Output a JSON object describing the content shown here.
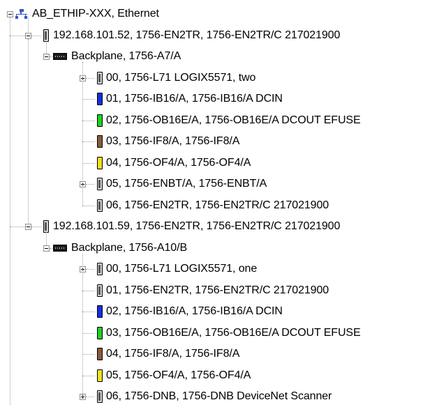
{
  "tree": {
    "root_label": "AB_ETHIP-XXX, Ethernet",
    "adapters": [
      {
        "label": "192.168.101.52, 1756-EN2TR, 1756-EN2TR/C 217021900",
        "backplane": "Backplane, 1756-A7/A",
        "modules": [
          {
            "label": "00, 1756-L71 LOGIX5571, two",
            "color": "#c8c8c8",
            "expandable": true
          },
          {
            "label": "01, 1756-IB16/A, 1756-IB16/A   DCIN",
            "color": "#1030e0",
            "expandable": false
          },
          {
            "label": "02, 1756-OB16E/A, 1756-OB16E/A  DCOUT EFUSE",
            "color": "#20d020",
            "expandable": false
          },
          {
            "label": "03, 1756-IF8/A, 1756-IF8/A",
            "color": "#8a5a3a",
            "expandable": false
          },
          {
            "label": "04, 1756-OF4/A, 1756-OF4/A",
            "color": "#f0e020",
            "expandable": false
          },
          {
            "label": "05, 1756-ENBT/A, 1756-ENBT/A",
            "color": "#c8c8c8",
            "expandable": true
          },
          {
            "label": "06, 1756-EN2TR, 1756-EN2TR/C 217021900",
            "color": "#c8c8c8",
            "expandable": false
          }
        ]
      },
      {
        "label": "192.168.101.59, 1756-EN2TR, 1756-EN2TR/C 217021900",
        "backplane": "Backplane, 1756-A10/B",
        "modules": [
          {
            "label": "00, 1756-L71 LOGIX5571, one",
            "color": "#c8c8c8",
            "expandable": true
          },
          {
            "label": "01, 1756-EN2TR, 1756-EN2TR/C 217021900",
            "color": "#c8c8c8",
            "expandable": false
          },
          {
            "label": "02, 1756-IB16/A, 1756-IB16/A   DCIN",
            "color": "#1030e0",
            "expandable": false
          },
          {
            "label": "03, 1756-OB16E/A, 1756-OB16E/A  DCOUT EFUSE",
            "color": "#20d020",
            "expandable": false
          },
          {
            "label": "04, 1756-IF8/A, 1756-IF8/A",
            "color": "#8a5a3a",
            "expandable": false
          },
          {
            "label": "05, 1756-OF4/A, 1756-OF4/A",
            "color": "#f0e020",
            "expandable": false
          },
          {
            "label": "06, 1756-DNB, 1756-DNB DeviceNet Scanner",
            "color": "#c8c8c8",
            "expandable": true
          }
        ]
      }
    ]
  }
}
